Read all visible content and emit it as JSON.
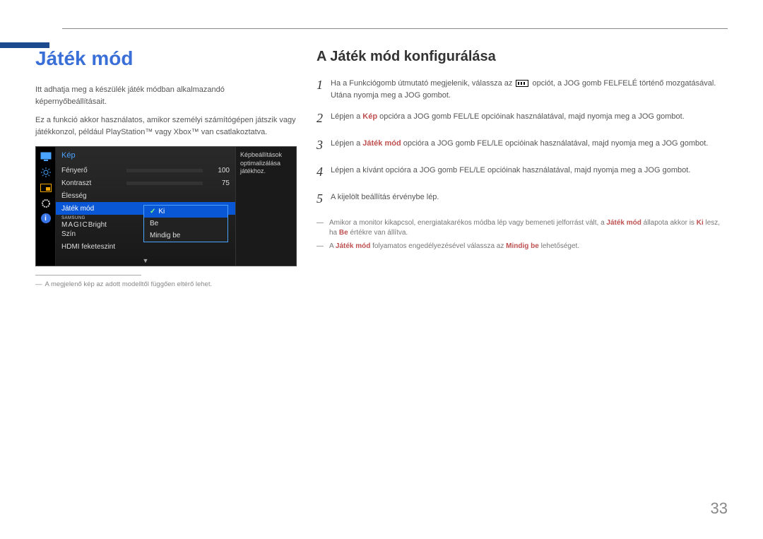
{
  "page_number": "33",
  "left": {
    "heading": "Játék mód",
    "paragraphs": [
      "Itt adhatja meg a készülék játék módban alkalmazandó képernyőbeállításait.",
      "Ez a funkció akkor használatos, amikor személyi számítógépen játszik vagy játékkonzol, például PlayStation™ vagy Xbox™ van csatlakoztatva."
    ],
    "footnote": "A megjelenő kép az adott modelltől függően eltérő lehet."
  },
  "osd": {
    "title": "Kép",
    "rows": {
      "brightness": {
        "label": "Fényerő",
        "value": 100,
        "max": 100
      },
      "contrast": {
        "label": "Kontraszt",
        "value": 75,
        "max": 100
      },
      "sharpness": {
        "label": "Élesség"
      },
      "game_mode": {
        "label": "Játék mód"
      },
      "magic_bright": {
        "label_a": "SAMSUNG",
        "label_b": "MAGIC",
        "label_c": "Bright"
      },
      "color": {
        "label": "Szín"
      },
      "hdmi_black": {
        "label": "HDMI feketeszint"
      }
    },
    "popup": {
      "items": [
        "Ki",
        "Be",
        "Mindig be"
      ],
      "selected": "Ki"
    },
    "description": "Képbeállítások optimalizálása játékhoz."
  },
  "right": {
    "heading": "A Játék mód konfigurálása",
    "steps": [
      {
        "num": "1",
        "pre": "Ha a Funkciógomb útmutató megjelenik, válassza az ",
        "post": " opciót, a JOG gomb FELFELÉ történő mozgatásával. Utána nyomja meg a JOG gombot."
      },
      {
        "num": "2",
        "pre": "Lépjen a ",
        "hl": "Kép",
        "post": " opcióra a JOG gomb FEL/LE opcióinak használatával, majd nyomja meg a JOG gombot."
      },
      {
        "num": "3",
        "pre": "Lépjen a ",
        "hl": "Játék mód",
        "post": " opcióra a JOG gomb FEL/LE opcióinak használatával, majd nyomja meg a JOG gombot."
      },
      {
        "num": "4",
        "text": "Lépjen a kívánt opcióra a JOG gomb FEL/LE opcióinak használatával, majd nyomja meg a JOG gombot."
      },
      {
        "num": "5",
        "text": "A kijelölt beállítás érvénybe lép."
      }
    ],
    "notes": [
      {
        "parts": [
          "Amikor a monitor kikapcsol, energiatakarékos módba lép vagy bemeneti jelforrást vált, a ",
          "Játék mód",
          " állapota akkor is ",
          "Ki",
          " lesz, ha ",
          "Be",
          " értékre van állítva."
        ]
      },
      {
        "parts": [
          "A ",
          "Játék mód",
          " folyamatos engedélyezésével válassza az ",
          "Mindig be",
          " lehetőséget."
        ]
      }
    ]
  }
}
